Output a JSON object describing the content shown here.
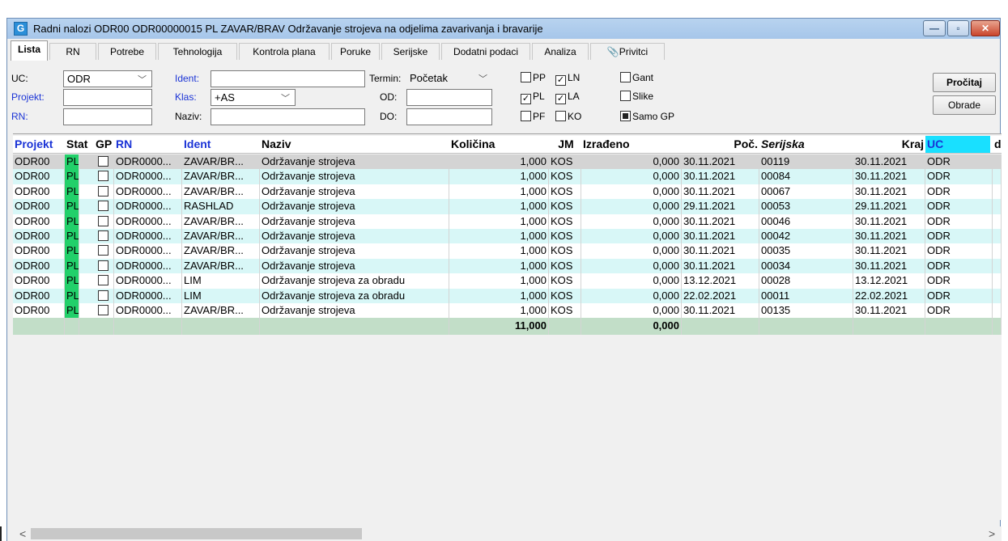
{
  "window": {
    "icon_letter": "G",
    "title": "Radni nalozi  ODR00 ODR00000015 PL ZAVAR/BRAV Održavanje strojeva na odjelima zavarivanja i bravarije",
    "minimize_glyph": "—",
    "maximize_glyph": "▫",
    "close_glyph": "✕"
  },
  "tabs": [
    {
      "label": "Lista",
      "active": true
    },
    {
      "label": "RN"
    },
    {
      "label": "Potrebe"
    },
    {
      "label": "Tehnologija"
    },
    {
      "label": "Kontrola plana"
    },
    {
      "label": "Poruke"
    },
    {
      "label": "Serijske"
    },
    {
      "label": "Dodatni podaci"
    },
    {
      "label": "Analiza"
    },
    {
      "label": "Privitci",
      "icon": "paperclip-icon"
    }
  ],
  "filters": {
    "uc_label": "UC:",
    "uc_value": "ODR",
    "ident_label": "Ident:",
    "ident_value": "",
    "termin_label": "Termin:",
    "termin_value": "Početak",
    "projekt_label": "Projekt:",
    "projekt_value": "",
    "klas_label": "Klas:",
    "klas_value": "+AS",
    "od_label": "OD:",
    "od_value": "",
    "rn_label": "RN:",
    "rn_value": "",
    "naziv_label": "Naziv:",
    "naziv_value": "",
    "do_label": "DO:",
    "do_value": "",
    "checkboxes": {
      "pp": {
        "label": "PP",
        "checked": false
      },
      "ln": {
        "label": "LN",
        "checked": true
      },
      "gant": {
        "label": "Gant",
        "checked": false
      },
      "pl": {
        "label": "PL",
        "checked": true
      },
      "la": {
        "label": "LA",
        "checked": true
      },
      "slike": {
        "label": "Slike",
        "checked": false
      },
      "pf": {
        "label": "PF",
        "checked": false
      },
      "ko": {
        "label": "KO",
        "checked": false
      },
      "samo_gp": {
        "label": "Samo GP",
        "checked": true
      }
    },
    "citaj_button": "Pročitaj",
    "obrade_button": "Obrade"
  },
  "table": {
    "headers": {
      "projekt": "Projekt",
      "stat": "Stat",
      "gp": "GP",
      "rn": "RN",
      "ident": "Ident",
      "naziv": "Naziv",
      "kolicina": "Količina",
      "jm": "JM",
      "izradeno": "Izrađeno",
      "poc": "Poč.",
      "serijska": "Serijska",
      "kraj": "Kraj",
      "uc": "UC",
      "d": "d"
    },
    "rows": [
      {
        "projekt": "ODR00",
        "stat": "PL",
        "rn": "ODR0000...",
        "ident": "ZAVAR/BR...",
        "naziv": "Održavanje strojeva",
        "kolicina": "1,000",
        "jm": "KOS",
        "izradeno": "0,000",
        "poc": "30.11.2021",
        "serijska": "00119",
        "kraj": "30.11.2021",
        "uc": "ODR"
      },
      {
        "projekt": "ODR00",
        "stat": "PL",
        "rn": "ODR0000...",
        "ident": "ZAVAR/BR...",
        "naziv": "Održavanje strojeva",
        "kolicina": "1,000",
        "jm": "KOS",
        "izradeno": "0,000",
        "poc": "30.11.2021",
        "serijska": "00084",
        "kraj": "30.11.2021",
        "uc": "ODR"
      },
      {
        "projekt": "ODR00",
        "stat": "PL",
        "rn": "ODR0000...",
        "ident": "ZAVAR/BR...",
        "naziv": "Održavanje strojeva",
        "kolicina": "1,000",
        "jm": "KOS",
        "izradeno": "0,000",
        "poc": "30.11.2021",
        "serijska": "00067",
        "kraj": "30.11.2021",
        "uc": "ODR"
      },
      {
        "projekt": "ODR00",
        "stat": "PL",
        "rn": "ODR0000...",
        "ident": "RASHLAD",
        "naziv": "Održavanje strojeva",
        "kolicina": "1,000",
        "jm": "KOS",
        "izradeno": "0,000",
        "poc": "29.11.2021",
        "serijska": "00053",
        "kraj": "29.11.2021",
        "uc": "ODR"
      },
      {
        "projekt": "ODR00",
        "stat": "PL",
        "rn": "ODR0000...",
        "ident": "ZAVAR/BR...",
        "naziv": "Održavanje strojeva",
        "kolicina": "1,000",
        "jm": "KOS",
        "izradeno": "0,000",
        "poc": "30.11.2021",
        "serijska": "00046",
        "kraj": "30.11.2021",
        "uc": "ODR"
      },
      {
        "projekt": "ODR00",
        "stat": "PL",
        "rn": "ODR0000...",
        "ident": "ZAVAR/BR...",
        "naziv": "Održavanje strojeva",
        "kolicina": "1,000",
        "jm": "KOS",
        "izradeno": "0,000",
        "poc": "30.11.2021",
        "serijska": "00042",
        "kraj": "30.11.2021",
        "uc": "ODR"
      },
      {
        "projekt": "ODR00",
        "stat": "PL",
        "rn": "ODR0000...",
        "ident": "ZAVAR/BR...",
        "naziv": "Održavanje strojeva",
        "kolicina": "1,000",
        "jm": "KOS",
        "izradeno": "0,000",
        "poc": "30.11.2021",
        "serijska": "00035",
        "kraj": "30.11.2021",
        "uc": "ODR"
      },
      {
        "projekt": "ODR00",
        "stat": "PL",
        "rn": "ODR0000...",
        "ident": "ZAVAR/BR...",
        "naziv": "Održavanje strojeva",
        "kolicina": "1,000",
        "jm": "KOS",
        "izradeno": "0,000",
        "poc": "30.11.2021",
        "serijska": "00034",
        "kraj": "30.11.2021",
        "uc": "ODR"
      },
      {
        "projekt": "ODR00",
        "stat": "PL",
        "rn": "ODR0000...",
        "ident": "LIM",
        "naziv": "Održavanje strojeva za obradu",
        "kolicina": "1,000",
        "jm": "KOS",
        "izradeno": "0,000",
        "poc": "13.12.2021",
        "serijska": "00028",
        "kraj": "13.12.2021",
        "uc": "ODR"
      },
      {
        "projekt": "ODR00",
        "stat": "PL",
        "rn": "ODR0000...",
        "ident": "LIM",
        "naziv": "Održavanje strojeva za obradu",
        "kolicina": "1,000",
        "jm": "KOS",
        "izradeno": "0,000",
        "poc": "22.02.2021",
        "serijska": "00011",
        "kraj": "22.02.2021",
        "uc": "ODR"
      },
      {
        "projekt": "ODR00",
        "stat": "PL",
        "rn": "ODR0000...",
        "ident": "ZAVAR/BR...",
        "naziv": "Održavanje strojeva",
        "kolicina": "1,000",
        "jm": "KOS",
        "izradeno": "0,000",
        "poc": "30.11.2021",
        "serijska": "00135",
        "kraj": "30.11.2021",
        "uc": "ODR"
      }
    ],
    "totals": {
      "kolicina": "11,000",
      "izradeno": "0,000"
    }
  },
  "scrollbar": {
    "left_arrow": "<",
    "right_arrow": ">"
  },
  "colors": {
    "stat_green": "#22d06a",
    "uc_cyan": "#19e0ff",
    "header_blue": "#1a33d6",
    "odd_row": "#d8f7f7",
    "total_row": "#c2dec8"
  }
}
